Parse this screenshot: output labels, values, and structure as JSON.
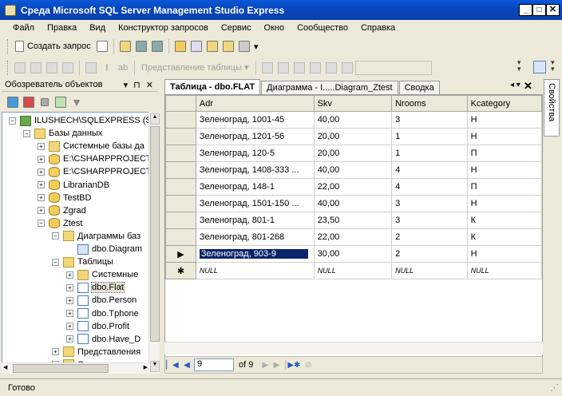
{
  "window": {
    "title": "Среда Microsoft SQL Server Management Studio Express"
  },
  "menu": [
    "Файл",
    "Правка",
    "Вид",
    "Конструктор запросов",
    "Сервис",
    "Окно",
    "Сообщество",
    "Справка"
  ],
  "toolbar": {
    "new_query": "Создать запрос",
    "table_view": "Представление таблицы"
  },
  "object_explorer": {
    "title": "Обозреватель объектов",
    "pin": "▾ ⊓ ✕",
    "tree": [
      {
        "label": "ILUSHECH\\SQLEXPRESS (SQ",
        "level": 0,
        "icon": "server",
        "exp": "−"
      },
      {
        "label": "Базы данных",
        "level": 1,
        "icon": "folder",
        "exp": "−"
      },
      {
        "label": "Системные базы да",
        "level": 2,
        "icon": "folder",
        "exp": "+"
      },
      {
        "label": "E:\\CSHARPPROJECT",
        "level": 2,
        "icon": "db",
        "exp": "+"
      },
      {
        "label": "E:\\CSHARPPROJECT",
        "level": 2,
        "icon": "db",
        "exp": "+"
      },
      {
        "label": "LibrarianDB",
        "level": 2,
        "icon": "db",
        "exp": "+"
      },
      {
        "label": "TestBD",
        "level": 2,
        "icon": "db",
        "exp": "+"
      },
      {
        "label": "Zgrad",
        "level": 2,
        "icon": "db",
        "exp": "+"
      },
      {
        "label": "Ztest",
        "level": 2,
        "icon": "db",
        "exp": "−"
      },
      {
        "label": "Диаграммы баз",
        "level": 3,
        "icon": "folder",
        "exp": "−"
      },
      {
        "label": "dbo.Diagram",
        "level": 4,
        "icon": "diagram",
        "exp": ""
      },
      {
        "label": "Таблицы",
        "level": 3,
        "icon": "folder",
        "exp": "−"
      },
      {
        "label": "Системные",
        "level": 4,
        "icon": "folder",
        "exp": "+"
      },
      {
        "label": "dbo.Flat",
        "level": 4,
        "icon": "table",
        "exp": "+",
        "selected": true
      },
      {
        "label": "dbo.Person",
        "level": 4,
        "icon": "table",
        "exp": "+"
      },
      {
        "label": "dbo.Tphone",
        "level": 4,
        "icon": "table",
        "exp": "+"
      },
      {
        "label": "dbo.Profit",
        "level": 4,
        "icon": "table",
        "exp": "+"
      },
      {
        "label": "dbo.Have_D",
        "level": 4,
        "icon": "table",
        "exp": "+"
      },
      {
        "label": "Представления",
        "level": 3,
        "icon": "folder",
        "exp": "+"
      },
      {
        "label": "Синонимы",
        "level": 3,
        "icon": "folder",
        "exp": "+"
      }
    ]
  },
  "tabs": [
    "Таблица - dbo.FLAT",
    "Диаграмма - I.....Diagram_Ztest",
    "Сводка"
  ],
  "grid": {
    "columns": [
      "Adr",
      "Skv",
      "Nrooms",
      "Kcategory"
    ],
    "rows": [
      {
        "marker": "",
        "cells": [
          "Зеленоград, 1001-45",
          "40,00",
          "3",
          "Н"
        ]
      },
      {
        "marker": "",
        "cells": [
          "Зеленоград, 1201-56",
          "20,00",
          "1",
          "Н"
        ]
      },
      {
        "marker": "",
        "cells": [
          "Зеленоград, 120-5",
          "20,00",
          "1",
          "П"
        ]
      },
      {
        "marker": "",
        "cells": [
          "Зеленоград, 1408-333    ...",
          "40,00",
          "4",
          "Н"
        ]
      },
      {
        "marker": "",
        "cells": [
          "Зеленоград, 148-1",
          "22,00",
          "4",
          "П"
        ]
      },
      {
        "marker": "",
        "cells": [
          "Зеленоград, 1501-150    ...",
          "40,00",
          "3",
          "Н"
        ]
      },
      {
        "marker": "",
        "cells": [
          "Зеленоград, 801-1",
          "23,50",
          "3",
          "К"
        ]
      },
      {
        "marker": "",
        "cells": [
          "Зеленоград, 801-268",
          "22,00",
          "2",
          "К"
        ]
      },
      {
        "marker": "▶",
        "cells": [
          "Зеленоград, 903-9",
          "30,00",
          "2",
          "Н"
        ],
        "editing": true
      },
      {
        "marker": "✱",
        "cells": [
          "NULL",
          "NULL",
          "NULL",
          "NULL"
        ],
        "null": true
      }
    ]
  },
  "navigator": {
    "current": "9",
    "of_label": "of 9"
  },
  "properties_label": "Свойства",
  "status": "Готово"
}
